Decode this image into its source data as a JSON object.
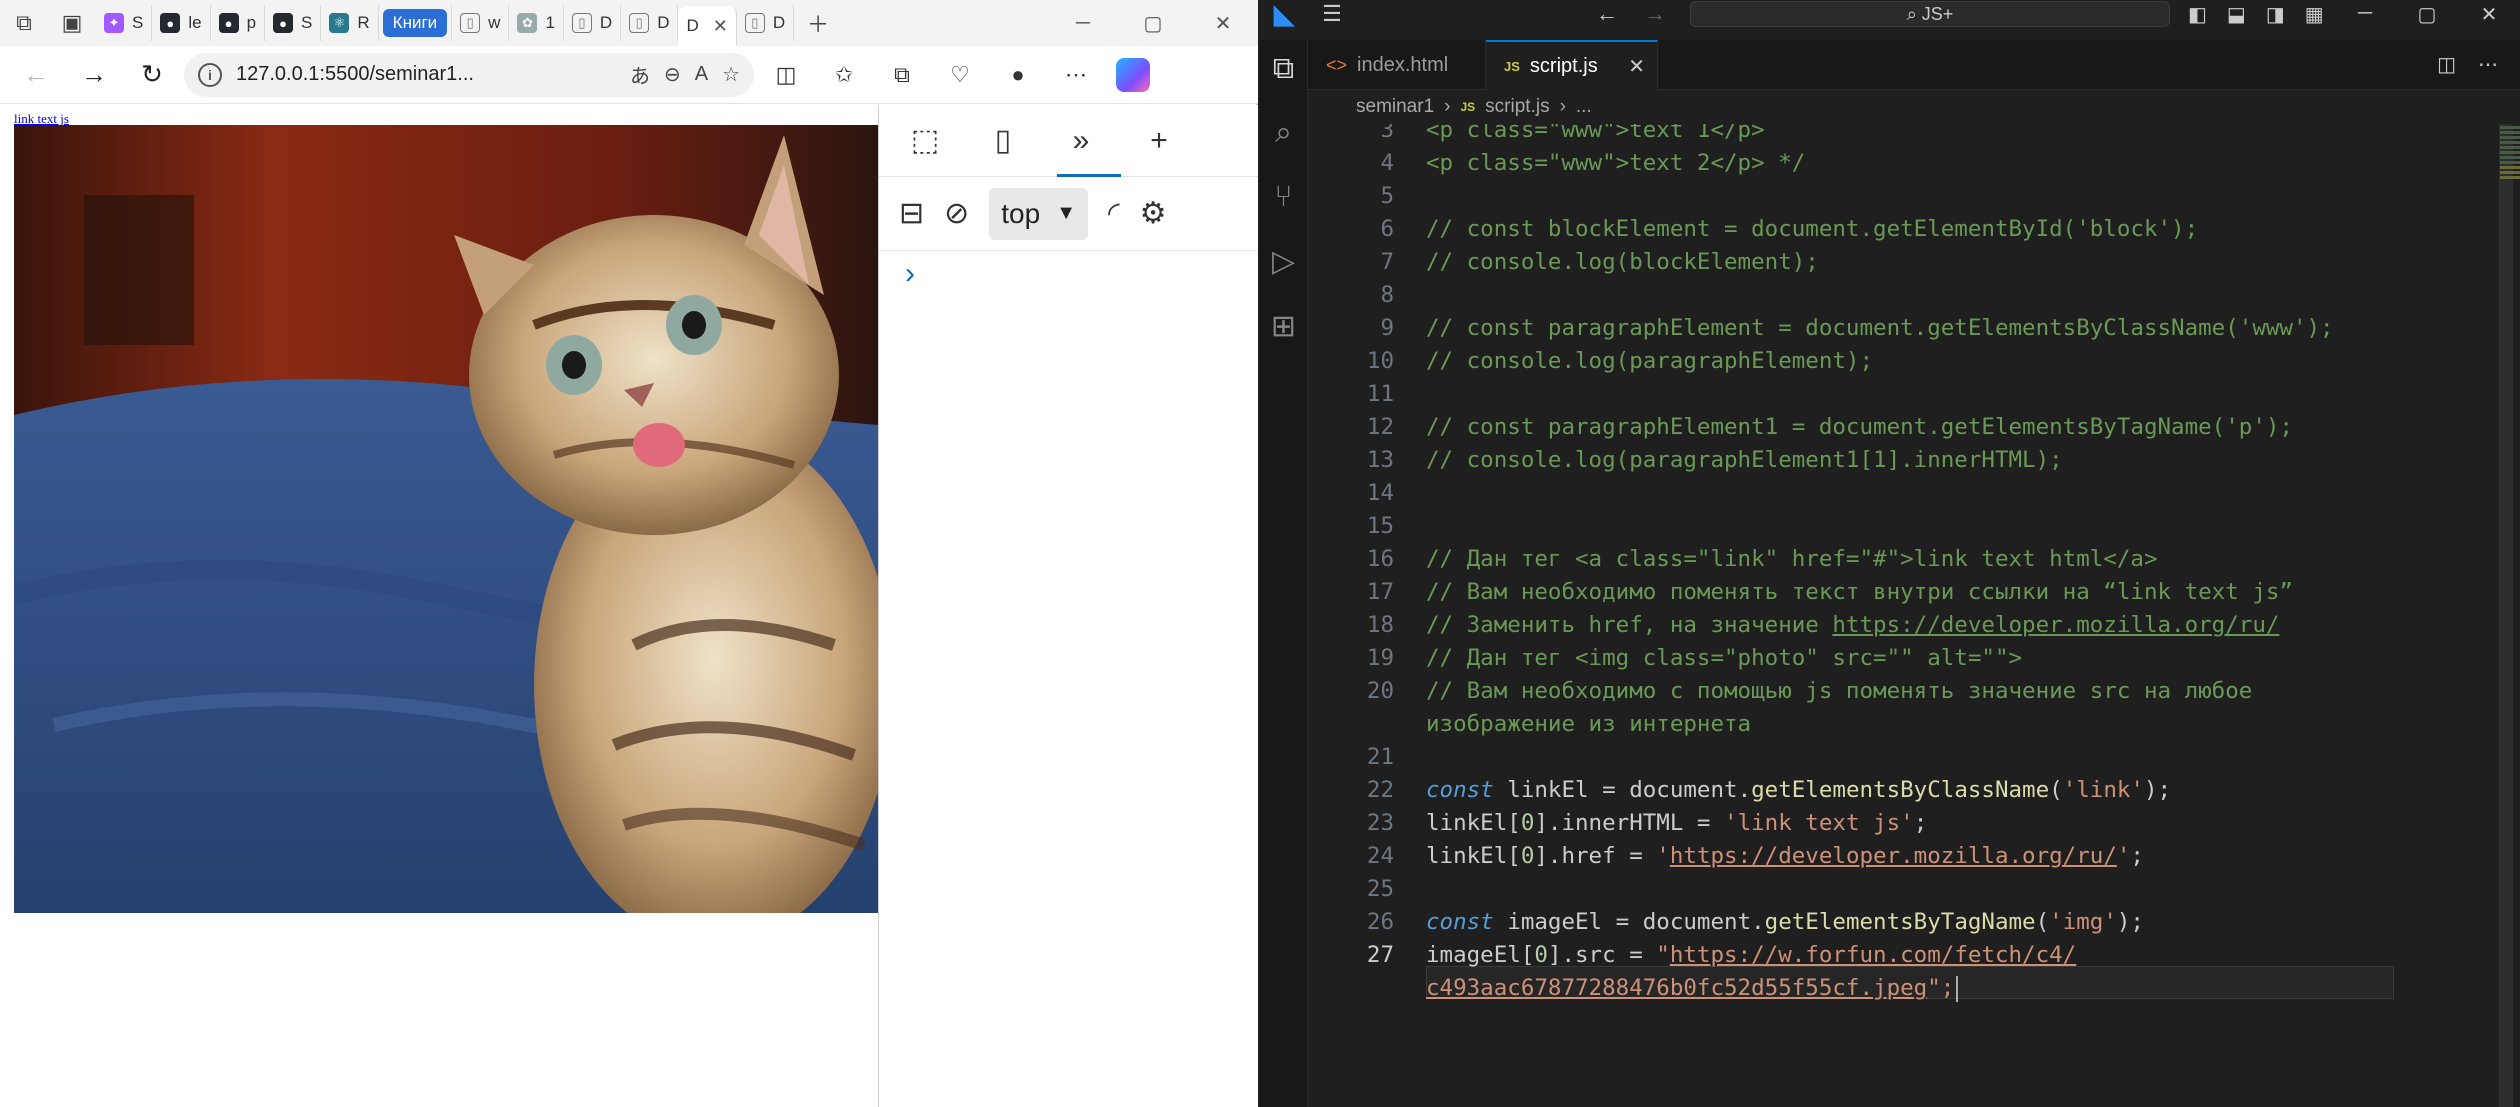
{
  "browser": {
    "tabs": [
      {
        "label": "S",
        "icon": "figma"
      },
      {
        "label": "le",
        "icon": "github"
      },
      {
        "label": "p",
        "icon": "github"
      },
      {
        "label": "S",
        "icon": "github"
      },
      {
        "label": "R",
        "icon": "react"
      },
      {
        "label": "w",
        "icon": "page"
      },
      {
        "label": "1",
        "icon": "puzzle"
      },
      {
        "label": "D",
        "icon": "page"
      },
      {
        "label": "D",
        "icon": "page"
      },
      {
        "label": "D",
        "icon": "page"
      },
      {
        "label": "D",
        "icon": "page"
      }
    ],
    "tab_group": "Книги",
    "url": "127.0.0.1:5500/seminar1...",
    "page": {
      "link_text": "link text js"
    },
    "devtools": {
      "context": "top"
    }
  },
  "vscode": {
    "search": "JS+",
    "tabs": [
      {
        "label": "index.html",
        "type": "html"
      },
      {
        "label": "script.js",
        "type": "js"
      }
    ],
    "breadcrumb": [
      "seminar1",
      "script.js",
      "..."
    ],
    "code": [
      {
        "n": "3",
        "text": "<p class=\"www\">text 1</p>"
      },
      {
        "n": "4",
        "text": "<p class=\"www\">text 2</p> */"
      },
      {
        "n": "5",
        "text": ""
      },
      {
        "n": "6",
        "text": "// const blockElement = document.getElementById('block');"
      },
      {
        "n": "7",
        "text": "// console.log(blockElement);"
      },
      {
        "n": "8",
        "text": ""
      },
      {
        "n": "9",
        "text": "// const paragraphElement = document.getElementsByClassName('www');"
      },
      {
        "n": "10",
        "text": "// console.log(paragraphElement);"
      },
      {
        "n": "11",
        "text": ""
      },
      {
        "n": "12",
        "text": "// const paragraphElement1 = document.getElementsByTagName('p');"
      },
      {
        "n": "13",
        "text": "// console.log(paragraphElement1[1].innerHTML);"
      },
      {
        "n": "14",
        "text": ""
      },
      {
        "n": "15",
        "text": ""
      },
      {
        "n": "16",
        "text": "// Дан тег <a class=\"link\" href=\"#\">link text html</a>"
      },
      {
        "n": "17",
        "text": "// Вам необходимо поменять текст внутри ссылки на “link text js”"
      },
      {
        "n": "18",
        "text": "// Заменить href, на значение https://developer.mozilla.org/ru/"
      },
      {
        "n": "19",
        "text": "// Дан тег <img class=\"photo\" src=\"\" alt=\"\">"
      },
      {
        "n": "20",
        "text": "// Вам необходимо с помощью js поменять значение src на любое"
      },
      {
        "n": "",
        "text": "изображение из интернета"
      },
      {
        "n": "21",
        "text": ""
      },
      {
        "n": "22",
        "text": "const linkEl = document.getElementsByClassName('link');"
      },
      {
        "n": "23",
        "text": "linkEl[0].innerHTML = 'link text js';"
      },
      {
        "n": "24",
        "text": "linkEl[0].href = 'https://developer.mozilla.org/ru/';"
      },
      {
        "n": "25",
        "text": ""
      },
      {
        "n": "26",
        "text": "const imageEl = document.getElementsByTagName('img');"
      },
      {
        "n": "27",
        "text": "imageEl[0].src = \"https://w.forfun.com/fetch/c4/"
      },
      {
        "n": "",
        "text": "c493aac67877288476b0fc52d55f55cf.jpeg\";"
      }
    ]
  }
}
